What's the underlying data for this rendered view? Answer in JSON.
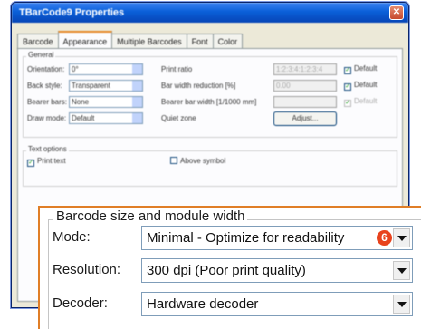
{
  "window": {
    "title": "TBarCode9 Properties",
    "close_glyph": "✕"
  },
  "tabs": [
    "Barcode",
    "Appearance",
    "Multiple Barcodes",
    "Font",
    "Color"
  ],
  "general": {
    "title": "General",
    "orientation": {
      "label": "Orientation:",
      "value": "0°"
    },
    "back_style": {
      "label": "Back style:",
      "value": "Transparent"
    },
    "bearer_bars": {
      "label": "Bearer bars:",
      "value": "None"
    },
    "draw_mode": {
      "label": "Draw mode:",
      "value": "Default"
    },
    "print_ratio": {
      "label": "Print ratio",
      "value": "1:2:3:4:1:2:3:4"
    },
    "bar_width_reduction": {
      "label": "Bar width reduction [%]",
      "value": "0.00"
    },
    "bearer_bar_width": {
      "label": "Bearer bar width [1/1000 mm]"
    },
    "quiet_zone": {
      "label": "Quiet zone",
      "button": "Adjust..."
    },
    "default_label": "Default"
  },
  "text_options": {
    "title": "Text options",
    "print_text": "Print text",
    "above_symbol": "Above symbol"
  },
  "callout": {
    "group_title": "Barcode size and module width",
    "mode": {
      "label": "Mode:",
      "value": "Minimal - Optimize for readability",
      "badge": "6"
    },
    "resolution": {
      "label": "Resolution:",
      "value": "300 dpi (Poor print quality)"
    },
    "decoder": {
      "label": "Decoder:",
      "value": "Hardware decoder"
    }
  },
  "colors": {
    "titlebar": "#0a5fd8",
    "callout_border": "#e07e27",
    "badge": "#e8431d"
  }
}
